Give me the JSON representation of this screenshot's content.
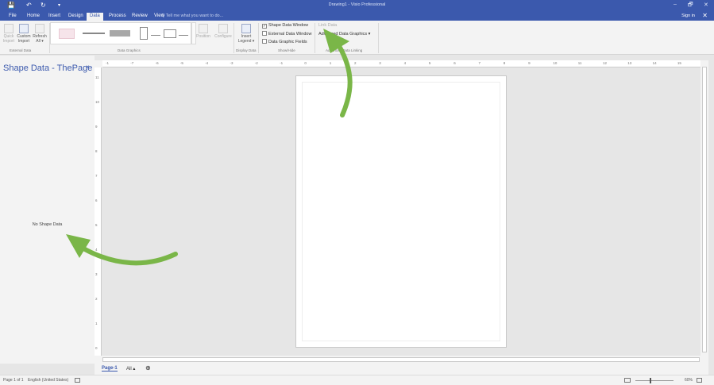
{
  "window": {
    "title": "Drawing1 - Visio Professional",
    "controls": [
      "–",
      "🗗",
      "✕"
    ],
    "save_icon": "💾",
    "undo_icon": "↶",
    "redo_icon": "↻",
    "qat_more": "▾"
  },
  "tabs": [
    "File",
    "Home",
    "Insert",
    "Design",
    "Data",
    "Process",
    "Review",
    "View"
  ],
  "active_tab": "Data",
  "tell_me": "Q Tell me what you want to do...",
  "sign_in": "Sign in",
  "close_glyph": "✕",
  "ribbon": {
    "external_data": {
      "label": "External Data",
      "quick_import": "Quick Import",
      "custom_import": "Custom Import",
      "refresh_all": "Refresh All ▾"
    },
    "data_graphics": {
      "label": "Data Graphics",
      "position": "Position",
      "configure": "Configure"
    },
    "display_data": {
      "label": "Display Data",
      "insert_legend": "Insert Legend ▾"
    },
    "show_hide": {
      "label": "Show/Hide",
      "shape_data_window": "Shape Data Window",
      "external_data_window": "External Data Window",
      "data_graphic_fields": "Data Graphic Fields",
      "check_mark": "✓"
    },
    "advanced": {
      "label": "Advanced Data Linking",
      "link_data": "Link Data",
      "advanced_data_graphics": "Advanced Data Graphics ▾"
    }
  },
  "panel": {
    "title": "Shape Data - ThePage",
    "close": "×",
    "empty_text": "No Shape Data"
  },
  "rulers": {
    "h_ticks": [
      "-1",
      "-7",
      "-6",
      "-5",
      "-4",
      "-3",
      "-2",
      "-1",
      "0",
      "1",
      "2",
      "3",
      "4",
      "5",
      "6",
      "7",
      "8",
      "9",
      "10",
      "11",
      "12",
      "13",
      "14",
      "15",
      "16"
    ],
    "v_ticks": [
      "11",
      "10",
      "9",
      "8",
      "7",
      "6",
      "5",
      "4",
      "3",
      "2",
      "1",
      "0"
    ]
  },
  "sheets": {
    "active": "Page-1",
    "all": "All ▴",
    "add": "⊕"
  },
  "status": {
    "page": "Page 1 of 1",
    "language": "English (United States)",
    "zoom": "60%"
  },
  "colors": {
    "accent": "#3b59ad",
    "arrow": "#7ab648"
  }
}
